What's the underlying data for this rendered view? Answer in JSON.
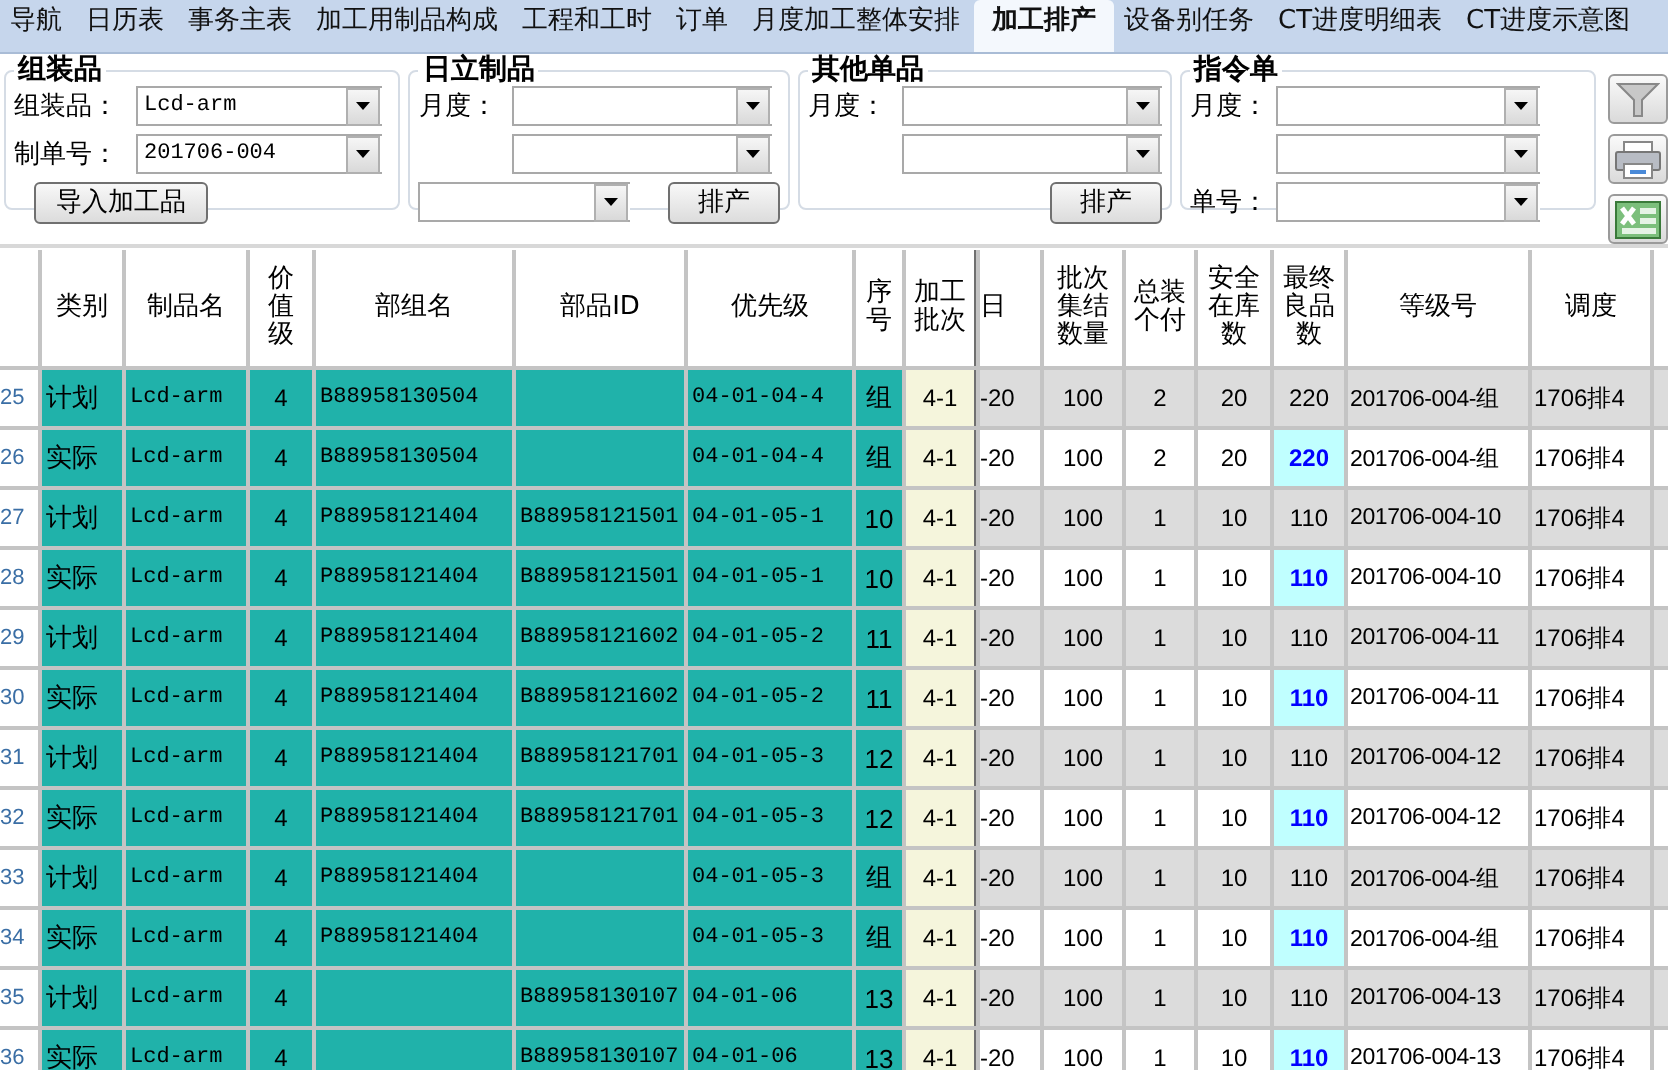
{
  "tabs": [
    {
      "label": "导航",
      "selected": false
    },
    {
      "label": "日历表",
      "selected": false
    },
    {
      "label": "事务主表",
      "selected": false
    },
    {
      "label": "加工用制品构成",
      "selected": false
    },
    {
      "label": "工程和工时",
      "selected": false
    },
    {
      "label": "订单",
      "selected": false
    },
    {
      "label": "月度加工整体安排",
      "selected": false
    },
    {
      "label": "加工排产",
      "selected": true
    },
    {
      "label": "设备别任务",
      "selected": false
    },
    {
      "label": "CT进度明细表",
      "selected": false
    },
    {
      "label": "CT进度示意图",
      "selected": false
    }
  ],
  "groups": [
    {
      "title": "组装品",
      "rows": [
        {
          "kind": "field",
          "label": "组装品：",
          "value": "Lcd-arm"
        },
        {
          "kind": "field",
          "label": "制单号：",
          "value": "201706-004"
        },
        {
          "kind": "button",
          "button": "导入加工品"
        }
      ]
    },
    {
      "title": "日立制品",
      "rows": [
        {
          "kind": "field",
          "label": "月度："
        },
        {
          "kind": "field"
        },
        {
          "kind": "actions",
          "combo": true,
          "button": "排产"
        }
      ]
    },
    {
      "title": "其他单品",
      "rows": [
        {
          "kind": "field",
          "label": "月度："
        },
        {
          "kind": "field"
        },
        {
          "kind": "actions",
          "combo": false,
          "button": "排产"
        }
      ]
    },
    {
      "title": "指令单",
      "rows": [
        {
          "kind": "field",
          "label": "月度："
        },
        {
          "kind": "field"
        },
        {
          "kind": "field",
          "label": "单号："
        }
      ]
    }
  ],
  "table": {
    "columns": [
      "类别",
      "制品名",
      "价值级",
      "部组名",
      "部品ID",
      "优先级",
      "序号",
      "加工批次",
      "日",
      "批次集结数量",
      "总装个付",
      "安全在库数",
      "最终良品数",
      "等级号",
      "调度"
    ],
    "rows": [
      {
        "number": "25",
        "kind": "plan",
        "cells": [
          "计划",
          "Lcd-arm",
          "4",
          "B88958130504",
          "",
          "04-01-04-4",
          "组",
          "4-1",
          "-20",
          "100",
          "2",
          "20",
          "220",
          "201706-004-组",
          "1706排4"
        ]
      },
      {
        "number": "26",
        "kind": "actual",
        "cells": [
          "实际",
          "Lcd-arm",
          "4",
          "B88958130504",
          "",
          "04-01-04-4",
          "组",
          "4-1",
          "-20",
          "100",
          "2",
          "20",
          "220",
          "201706-004-组",
          "1706排4"
        ]
      },
      {
        "number": "27",
        "kind": "plan",
        "cells": [
          "计划",
          "Lcd-arm",
          "4",
          "P88958121404",
          "B88958121501",
          "04-01-05-1",
          "10",
          "4-1",
          "-20",
          "100",
          "1",
          "10",
          "110",
          "201706-004-10",
          "1706排4"
        ]
      },
      {
        "number": "28",
        "kind": "actual",
        "cells": [
          "实际",
          "Lcd-arm",
          "4",
          "P88958121404",
          "B88958121501",
          "04-01-05-1",
          "10",
          "4-1",
          "-20",
          "100",
          "1",
          "10",
          "110",
          "201706-004-10",
          "1706排4"
        ]
      },
      {
        "number": "29",
        "kind": "plan",
        "cells": [
          "计划",
          "Lcd-arm",
          "4",
          "P88958121404",
          "B88958121602",
          "04-01-05-2",
          "11",
          "4-1",
          "-20",
          "100",
          "1",
          "10",
          "110",
          "201706-004-11",
          "1706排4"
        ]
      },
      {
        "number": "30",
        "kind": "actual",
        "cells": [
          "实际",
          "Lcd-arm",
          "4",
          "P88958121404",
          "B88958121602",
          "04-01-05-2",
          "11",
          "4-1",
          "-20",
          "100",
          "1",
          "10",
          "110",
          "201706-004-11",
          "1706排4"
        ]
      },
      {
        "number": "31",
        "kind": "plan",
        "cells": [
          "计划",
          "Lcd-arm",
          "4",
          "P88958121404",
          "B88958121701",
          "04-01-05-3",
          "12",
          "4-1",
          "-20",
          "100",
          "1",
          "10",
          "110",
          "201706-004-12",
          "1706排4"
        ]
      },
      {
        "number": "32",
        "kind": "actual",
        "cells": [
          "实际",
          "Lcd-arm",
          "4",
          "P88958121404",
          "B88958121701",
          "04-01-05-3",
          "12",
          "4-1",
          "-20",
          "100",
          "1",
          "10",
          "110",
          "201706-004-12",
          "1706排4"
        ]
      },
      {
        "number": "33",
        "kind": "plan",
        "cells": [
          "计划",
          "Lcd-arm",
          "4",
          "P88958121404",
          "",
          "04-01-05-3",
          "组",
          "4-1",
          "-20",
          "100",
          "1",
          "10",
          "110",
          "201706-004-组",
          "1706排4"
        ]
      },
      {
        "number": "34",
        "kind": "actual",
        "cells": [
          "实际",
          "Lcd-arm",
          "4",
          "P88958121404",
          "",
          "04-01-05-3",
          "组",
          "4-1",
          "-20",
          "100",
          "1",
          "10",
          "110",
          "201706-004-组",
          "1706排4"
        ]
      },
      {
        "number": "35",
        "kind": "plan",
        "cells": [
          "计划",
          "Lcd-arm",
          "4",
          "",
          "B88958130107",
          "04-01-06",
          "13",
          "4-1",
          "-20",
          "100",
          "1",
          "10",
          "110",
          "201706-004-13",
          "1706排4"
        ]
      },
      {
        "number": "36",
        "kind": "actual",
        "cells": [
          "实际",
          "Lcd-arm",
          "4",
          "",
          "B88958130107",
          "04-01-06",
          "13",
          "4-1",
          "-20",
          "100",
          "1",
          "10",
          "110",
          "201706-004-13",
          "1706排4"
        ]
      }
    ]
  }
}
